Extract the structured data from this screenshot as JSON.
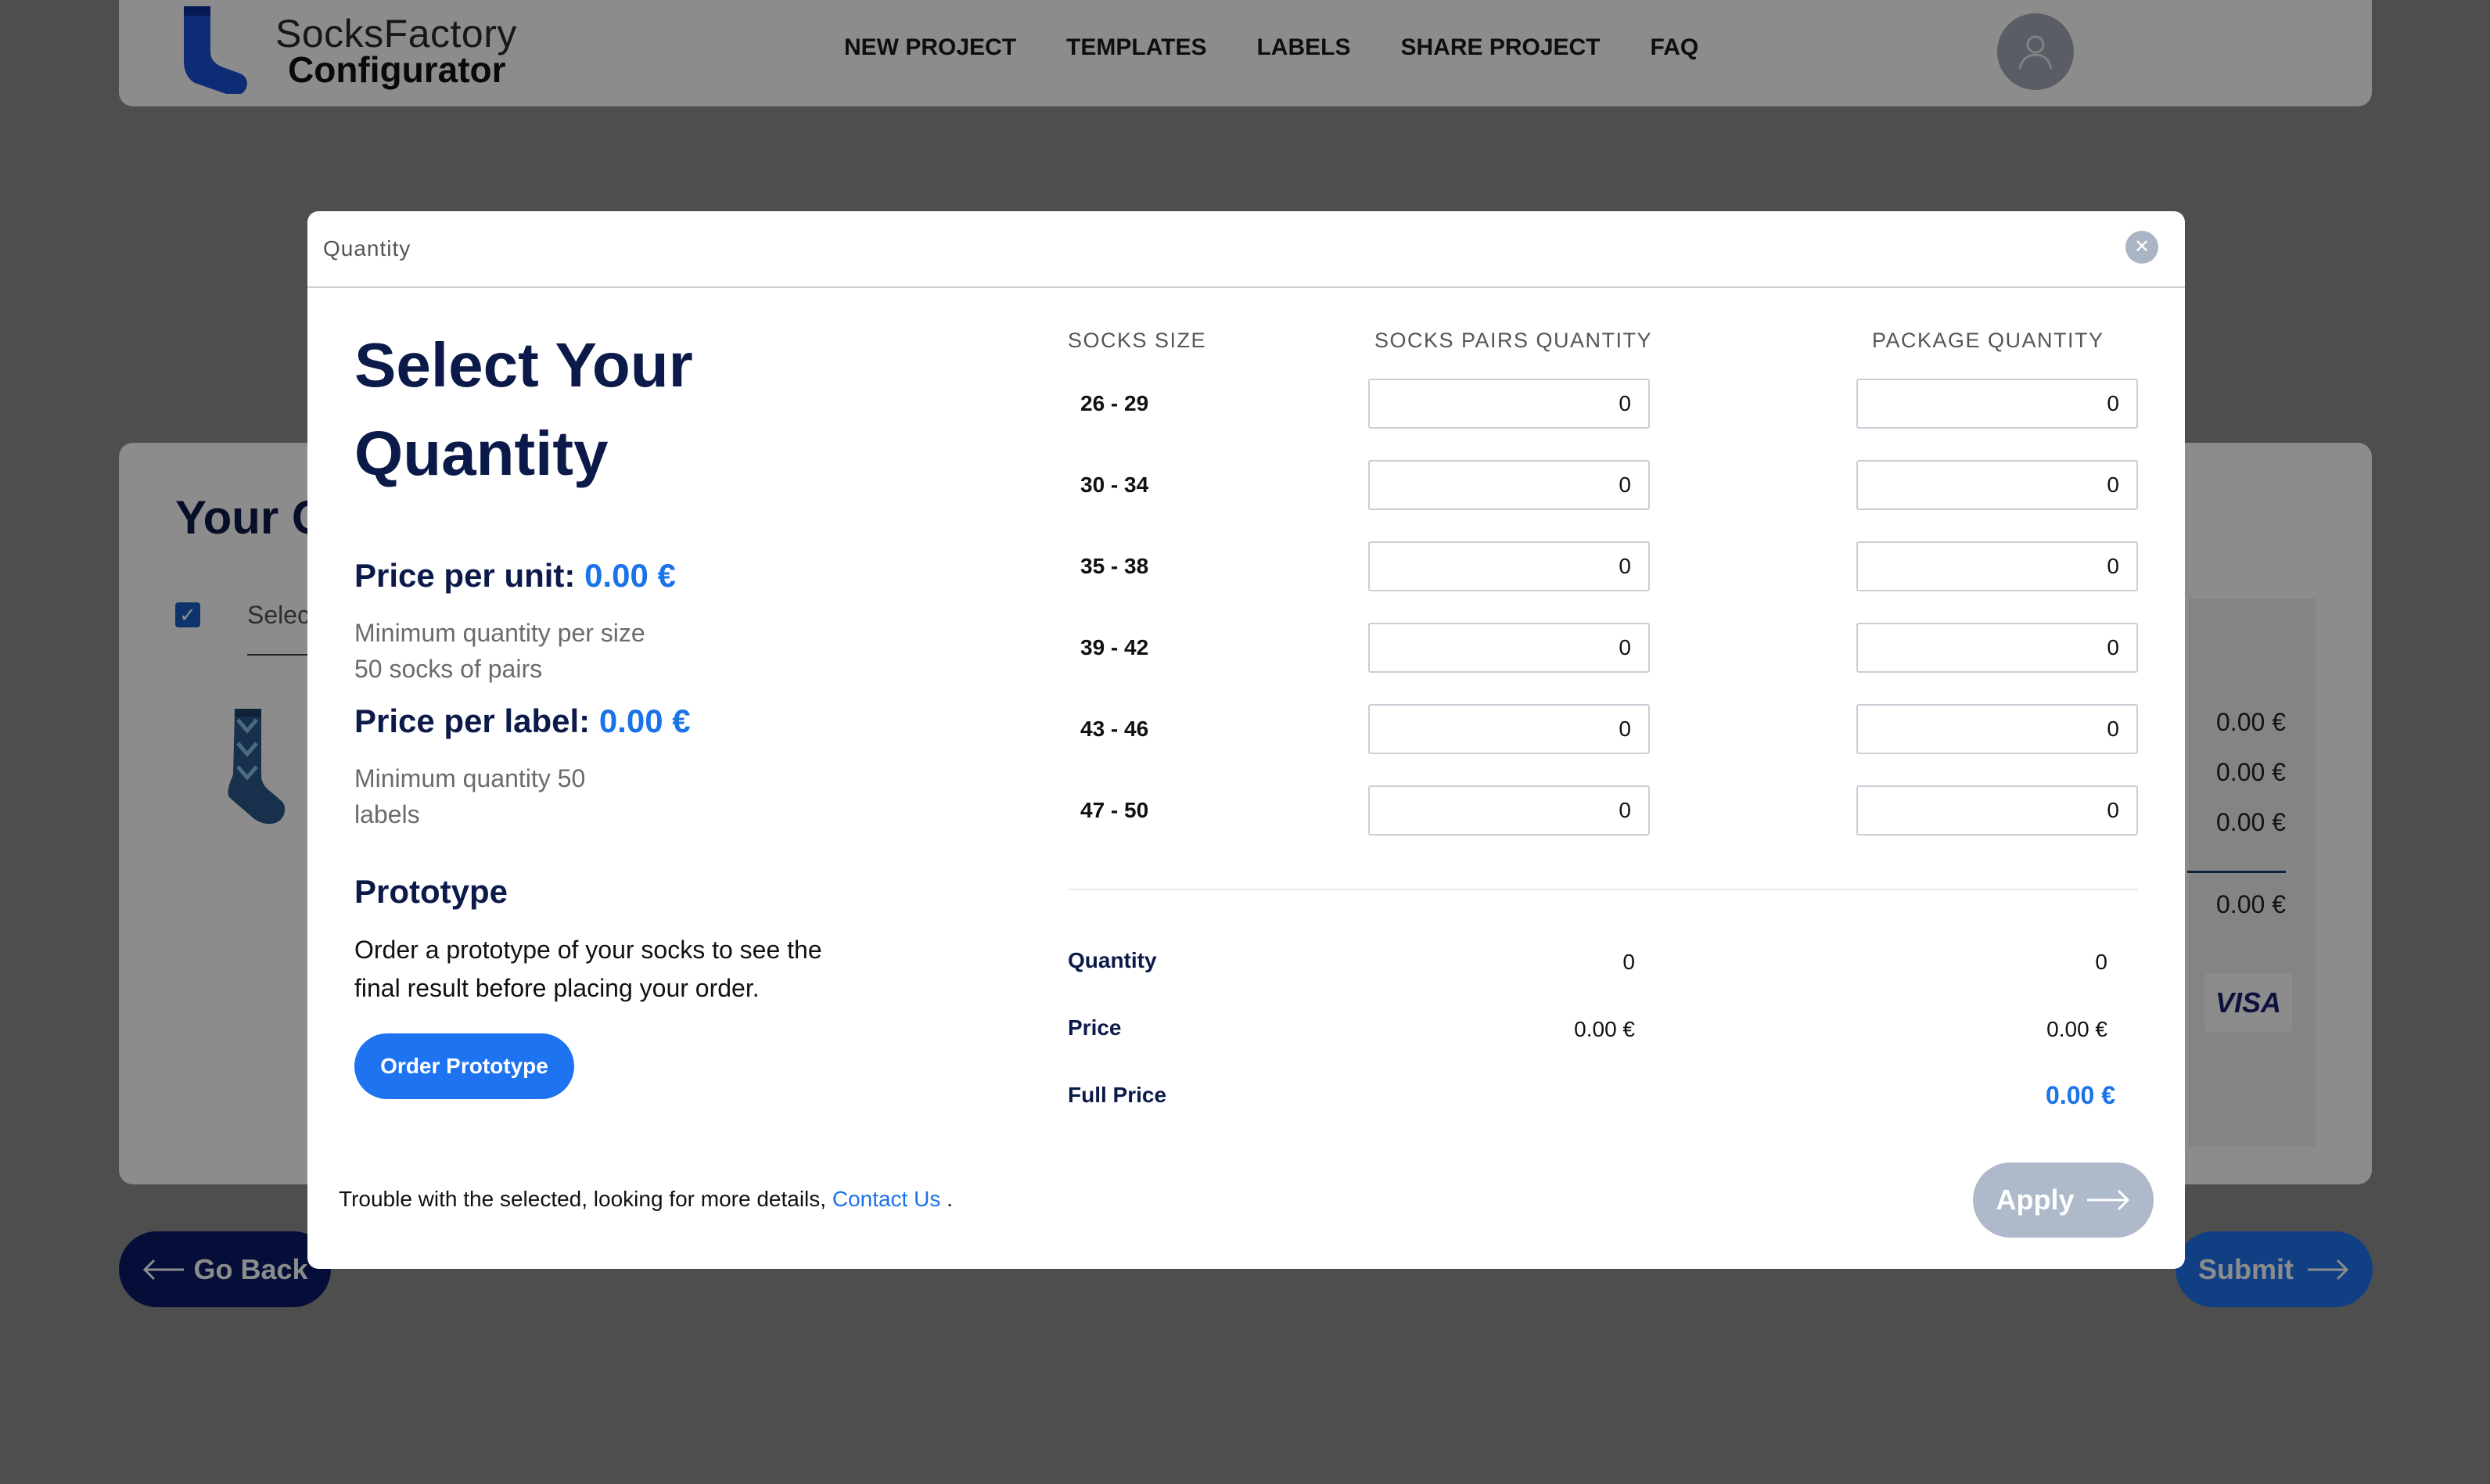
{
  "brand": {
    "line1": "SocksFactory",
    "line2": "Configurator",
    "color": "#1a4fd8"
  },
  "nav": [
    "NEW PROJECT",
    "TEMPLATES",
    "LABELS",
    "SHARE PROJECT",
    "FAQ"
  ],
  "background": {
    "title": "Your C",
    "select_text": "Selec",
    "prices": [
      "0.00 €",
      "0.00 €",
      "0.00 €",
      "0.00 €"
    ],
    "card_brand": "VISA",
    "go_back_label": "Go Back",
    "submit_label": "Submit"
  },
  "modal": {
    "header": "Quantity",
    "title": "Select Your Quantity",
    "price_per_unit_label": "Price per unit:",
    "price_per_unit_value": "0.00 €",
    "unit_hint": "Minimum quantity per size 50 socks of pairs",
    "price_per_label_label": "Price per label:",
    "price_per_label_value": "0.00 €",
    "label_hint": "Minimum quantity 50 labels",
    "prototype_title": "Prototype",
    "prototype_desc": "Order a prototype of your socks to see the final result before placing your order.",
    "order_button": "Order Prototype",
    "columns": [
      "SOCKS SIZE",
      "SOCKS PAIRS QUANTITY",
      "PACKAGE QUANTITY"
    ],
    "rows": [
      {
        "size": "26 - 29",
        "pairs": "0",
        "packages": "0"
      },
      {
        "size": "30 - 34",
        "pairs": "0",
        "packages": "0"
      },
      {
        "size": "35 - 38",
        "pairs": "0",
        "packages": "0"
      },
      {
        "size": "39 - 42",
        "pairs": "0",
        "packages": "0"
      },
      {
        "size": "43 - 46",
        "pairs": "0",
        "packages": "0"
      },
      {
        "size": "47 - 50",
        "pairs": "0",
        "packages": "0"
      }
    ],
    "summary": {
      "quantity_label": "Quantity",
      "quantity_pairs": "0",
      "quantity_packages": "0",
      "price_label": "Price",
      "price_pairs": "0.00 €",
      "price_packages": "0.00 €",
      "full_price_label": "Full Price",
      "full_price": "0.00 €"
    },
    "footer_text": "Trouble with the selected, looking for more details,",
    "footer_link": "Contact Us",
    "footer_end": ".",
    "apply_button": "Apply"
  },
  "colors": {
    "accent": "#1e73f0",
    "navy": "#0c1a4a",
    "apply_disabled": "#aeb9ca"
  }
}
